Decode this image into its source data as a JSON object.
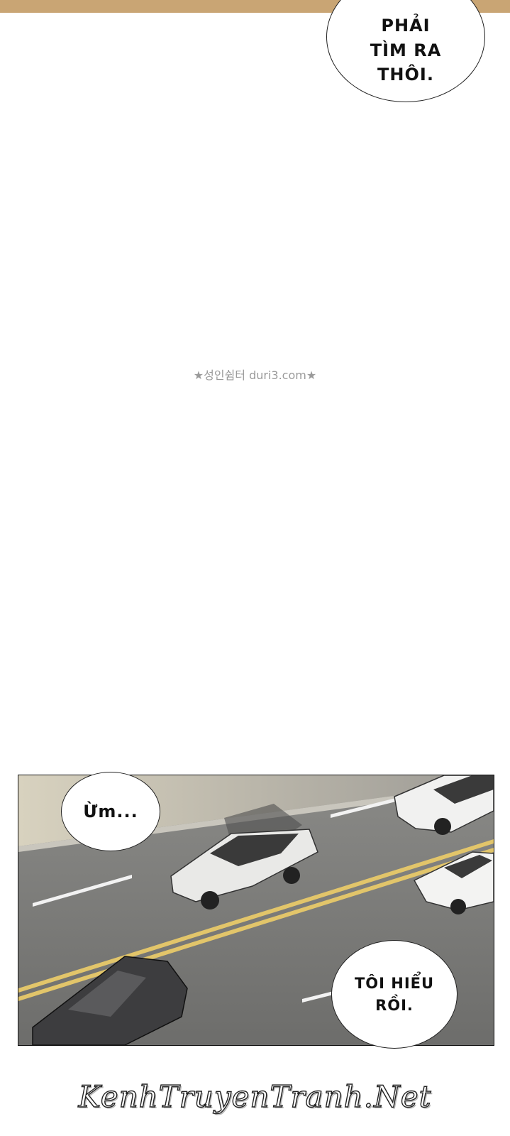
{
  "bubbles": {
    "top": "PHẢI\nTÌM RA\nTHÔI.",
    "panel_left": "Ừm...",
    "panel_right": "TÔI HIỂU\nRỒI."
  },
  "watermark": "★성인쉼터 duri3.com★",
  "footer": "KenhTruyenTranh.Net",
  "colors": {
    "road": "#7d7d7b",
    "sidewalk": "#b9b6ae",
    "lane_yellow": "#e2c56a",
    "lane_white": "#f2f2f2",
    "strip": "#c9a574"
  }
}
